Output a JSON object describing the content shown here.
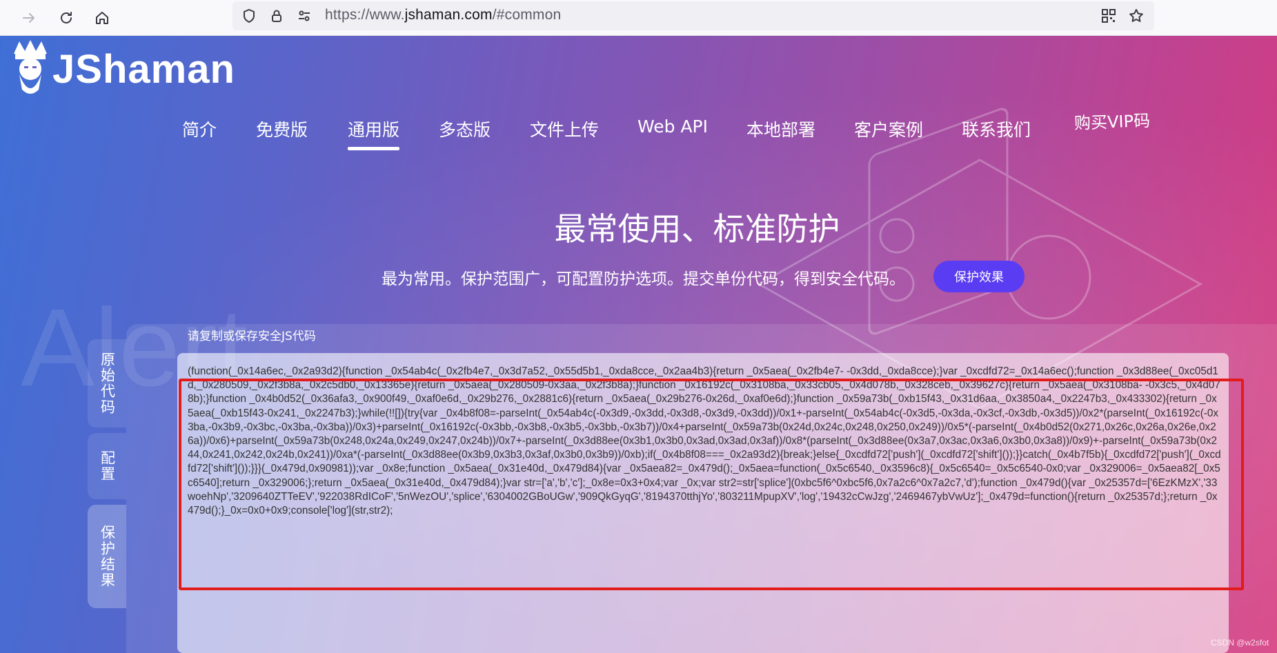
{
  "browser": {
    "url_prefix": "https://www.",
    "url_domain": "jshaman.com",
    "url_suffix": "/#common"
  },
  "logo": {
    "text": "JShaman"
  },
  "nav": {
    "items": [
      {
        "label": "简介"
      },
      {
        "label": "免费版"
      },
      {
        "label": "通用版",
        "active": true
      },
      {
        "label": "多态版"
      },
      {
        "label": "文件上传"
      },
      {
        "label": "Web API"
      },
      {
        "label": "本地部署"
      },
      {
        "label": "客户案例"
      },
      {
        "label": "联系我们"
      },
      {
        "label": "购买VIP码"
      }
    ]
  },
  "hero": {
    "title": "最常使用、标准防护",
    "subtitle": "最为常用。保护范围广，可配置防护选项。提交单份代码，得到安全代码。",
    "button": "保护效果"
  },
  "decoration": {
    "word": "Alert"
  },
  "side_tabs": [
    {
      "label": "原始代码"
    },
    {
      "label": "配置"
    },
    {
      "label": "保护结果",
      "active": true
    }
  ],
  "result": {
    "label": "请复制或保存安全JS代码",
    "code": "(function(_0x14a6ec,_0x2a93d2){function _0x54ab4c(_0x2fb4e7,_0x3d7a52,_0x55d5b1,_0xda8cce,_0x2aa4b3){return _0x5aea(_0x2fb4e7- -0x3dd,_0xda8cce);}var _0xcdfd72=_0x14a6ec();function _0x3d88ee(_0xc05d1d,_0x280509,_0x2f3b8a,_0x2c5db0,_0x13365e){return _0x5aea(_0x280509-0x3aa,_0x2f3b8a);}function _0x16192c(_0x3108ba,_0x33cb05,_0x4d078b,_0x328ceb,_0x39627c){return _0x5aea(_0x3108ba- -0x3c5,_0x4d078b);}function _0x4b0d52(_0x36afa3,_0x900f49,_0xaf0e6d,_0x29b276,_0x2881c6){return _0x5aea(_0x29b276-0x26d,_0xaf0e6d);}function _0x59a73b(_0xb15f43,_0x31d6aa,_0x3850a4,_0x2247b3,_0x433302){return _0x5aea(_0xb15f43-0x241,_0x2247b3);}while(!![]){try{var _0x4b8f08=-parseInt(_0x54ab4c(-0x3d9,-0x3dd,-0x3d8,-0x3d9,-0x3dd))/0x1+-parseInt(_0x54ab4c(-0x3d5,-0x3da,-0x3cf,-0x3db,-0x3d5))/0x2*(parseInt(_0x16192c(-0x3ba,-0x3b9,-0x3bc,-0x3ba,-0x3ba))/0x3)+parseInt(_0x16192c(-0x3bb,-0x3b8,-0x3b5,-0x3bb,-0x3b7))/0x4+parseInt(_0x59a73b(0x24d,0x24c,0x248,0x250,0x249))/0x5*(-parseInt(_0x4b0d52(0x271,0x26c,0x26a,0x26e,0x26a))/0x6)+parseInt(_0x59a73b(0x248,0x24a,0x249,0x247,0x24b))/0x7+-parseInt(_0x3d88ee(0x3b1,0x3b0,0x3ad,0x3ad,0x3af))/0x8*(parseInt(_0x3d88ee(0x3a7,0x3ac,0x3a6,0x3b0,0x3a8))/0x9)+-parseInt(_0x59a73b(0x244,0x241,0x242,0x24b,0x241))/0xa*(-parseInt(_0x3d88ee(0x3b9,0x3b3,0x3af,0x3b0,0x3b9))/0xb);if(_0x4b8f08===_0x2a93d2){break;}else{_0xcdfd72['push'](_0xcdfd72['shift']());}}catch(_0x4b7f5b){_0xcdfd72['push'](_0xcdfd72['shift']());}}}(_0x479d,0x90981));var _0x8e;function _0x5aea(_0x31e40d,_0x479d84){var _0x5aea82=_0x479d();_0x5aea=function(_0x5c6540,_0x3596c8){_0x5c6540=_0x5c6540-0x0;var _0x329006=_0x5aea82[_0x5c6540];return _0x329006;};return _0x5aea(_0x31e40d,_0x479d84);}var str=['a','b','c'];_0x8e=0x3+0x4;var _0x;var str2=str['splice'](0xbc5f6^0xbc5f6,0x7a2c6^0x7a2c7,'d');function _0x479d(){var _0x25357d=['6EzKMzX','33woehNp','3209640ZTTeEV','922038RdICoF','5nWezOU','splice','6304002GBoUGw','909QkGyqG','8194370tthjYo','803211MpupXV','log','19432cCwJzg','2469467ybVwUz'];_0x479d=function(){return _0x25357d;};return _0x479d();}_0x=0x0+0x9;console['log'](str,str2);"
  },
  "watermark": "CSDN @w2sfot"
}
